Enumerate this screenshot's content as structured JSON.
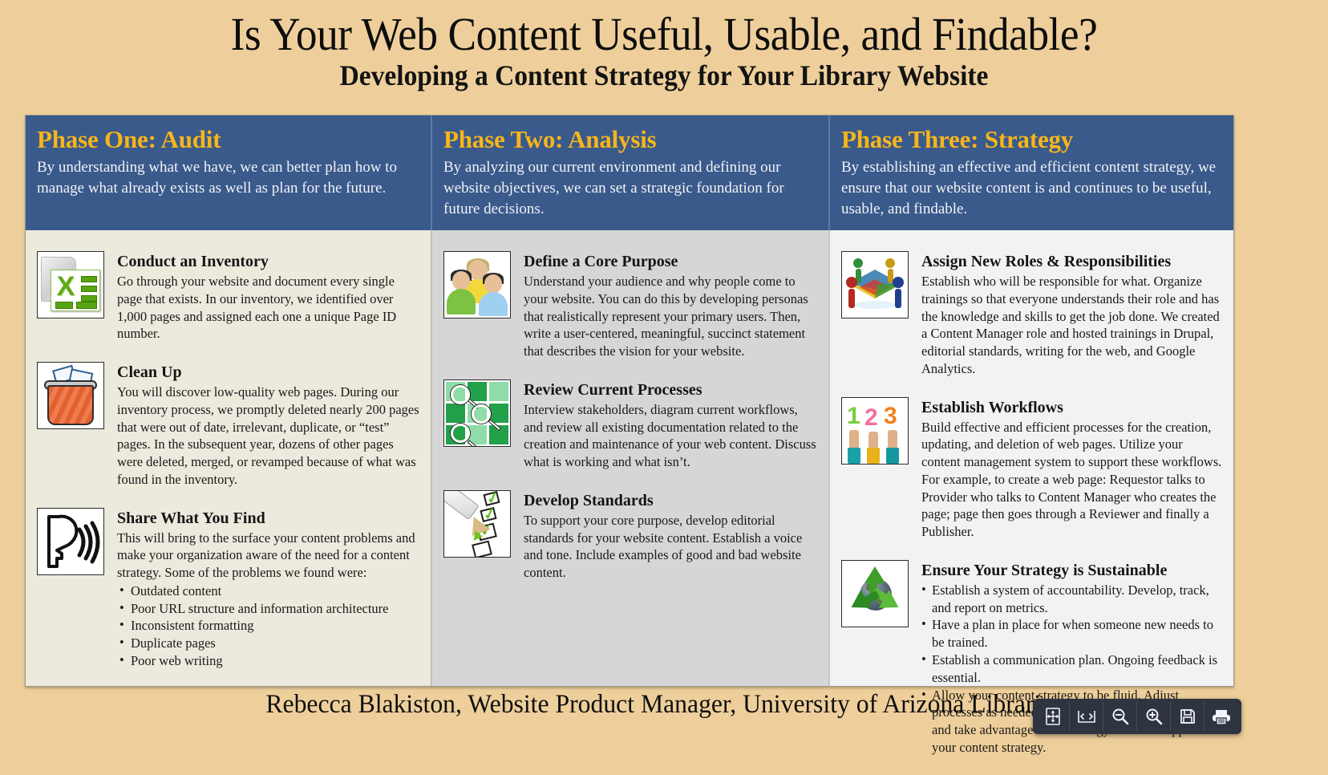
{
  "poster": {
    "title": "Is Your Web Content Useful, Usable, and Findable?",
    "subtitle": "Developing a Content Strategy for Your Library Website",
    "footer": "Rebecca Blakiston, Website Product Manager, University of Arizona Libraries",
    "colors": {
      "page_background": "#eecf9b",
      "header_band": "#3a5a8c",
      "phase_title": "#f8b519",
      "column_one_bg": "#eceadd",
      "column_two_bg": "#d6d6d6",
      "column_three_bg": "#f2f2f2"
    }
  },
  "phases": [
    {
      "title": "Phase One: Audit",
      "description": "By understanding what we have, we can better plan how to manage what already exists as well as plan for the future.",
      "items": [
        {
          "icon": "spreadsheet-icon",
          "title": "Conduct an Inventory",
          "text": "Go through your website and document every single page that exists. In our inventory, we identified over 1,000 pages and assigned each one a unique Page ID number.",
          "bullets": []
        },
        {
          "icon": "trash-bin-icon",
          "title": "Clean Up",
          "text": "You will discover low-quality web pages. During our inventory process, we promptly deleted nearly 200 pages that were out of date, irrelevant, duplicate, or “test” pages. In the subsequent year, dozens of other pages were deleted, merged, or revamped because of what was found in the inventory.",
          "bullets": []
        },
        {
          "icon": "speaking-head-icon",
          "title": "Share What You Find",
          "text": "This will bring to the surface your content problems and make your organization aware of the need for a content strategy. Some of the problems we found were:",
          "bullets": [
            "Outdated content",
            "Poor URL structure and information architecture",
            "Inconsistent formatting",
            "Duplicate pages",
            "Poor web writing"
          ]
        }
      ]
    },
    {
      "title": "Phase Two: Analysis",
      "description": "By analyzing our current environment and defining our website objectives, we can set a strategic foundation for future decisions.",
      "items": [
        {
          "icon": "people-group-icon",
          "title": "Define a Core Purpose",
          "text": "Understand your audience and why people come to your website. You can do this by developing personas that realistically represent your primary users. Then, write a user-centered, meaningful, succinct statement that describes the vision for your website.",
          "bullets": []
        },
        {
          "icon": "magnifier-grid-icon",
          "title": "Review Current Processes",
          "text": "Interview stakeholders, diagram current workflows, and review all existing documentation related to the creation and maintenance of your web content.  Discuss what is working and what isn’t.",
          "bullets": []
        },
        {
          "icon": "checklist-pencil-icon",
          "title": "Develop Standards",
          "text": "To support your core purpose, develop editorial standards for your website content. Establish a voice and tone. Include examples of good and bad website content.",
          "bullets": []
        }
      ]
    },
    {
      "title": "Phase Three: Strategy",
      "description": "By establishing an effective and efficient content strategy, we ensure that our website content is and continues to be useful, usable, and findable.",
      "items": [
        {
          "icon": "teamwork-roles-icon",
          "title": "Assign New Roles & Responsibilities",
          "text": "Establish who will be responsible for what. Organize trainings so that everyone understands their role and has the knowledge and skills to get the job done. We created a Content Manager role and hosted trainings in Drupal, editorial standards, writing for the web, and Google Analytics.",
          "bullets": []
        },
        {
          "icon": "numbers-123-icon",
          "title": "Establish Workflows",
          "text": "Build effective and efficient processes for the creation, updating, and deletion of web pages. Utilize your content management system to support these workflows. For example, to create a web page: Requestor talks to Provider who talks to Content Manager who creates the page; page then goes through a Reviewer and finally a Publisher.",
          "bullets": []
        },
        {
          "icon": "recycle-globe-icon",
          "title": "Ensure Your Strategy is Sustainable",
          "text": "",
          "bullets": [
            "Establish a system of accountability. Develop, track, and report on metrics.",
            "Have a plan in place for when someone new needs to be trained.",
            "Establish a communication plan. Ongoing feedback is essential.",
            "Allow your content strategy to be fluid. Adjust processes as needed, stay aware of new developments, and take advantage of technology that will support your content strategy."
          ]
        }
      ]
    }
  ],
  "toolbar": {
    "buttons": [
      {
        "icon": "fit-page-icon",
        "label": "Fit page"
      },
      {
        "icon": "fit-width-icon",
        "label": "Fit width"
      },
      {
        "icon": "zoom-out-icon",
        "label": "Zoom out"
      },
      {
        "icon": "zoom-in-icon",
        "label": "Zoom in"
      },
      {
        "icon": "save-icon",
        "label": "Save"
      },
      {
        "icon": "print-icon",
        "label": "Print"
      }
    ]
  }
}
